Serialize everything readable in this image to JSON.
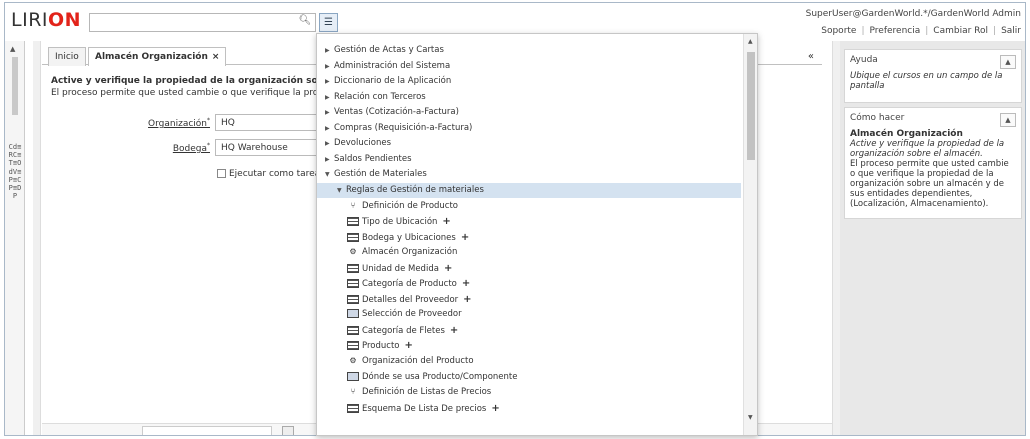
{
  "header": {
    "logo_a": "LIRI",
    "logo_b": "ON",
    "search_placeholder": "",
    "user": "SuperUser@GardenWorld.*/GardenWorld Admin",
    "links": [
      "Soporte",
      "Preferencia",
      "Cambiar Rol",
      "Salir"
    ]
  },
  "left_rail_text": "Cd≡RC≡T≡OdV≡P≡CP≡DP",
  "tabs": [
    "Inicio",
    "Almacén Organización"
  ],
  "process": {
    "title": "Active y verifique la propiedad de la organización sobre el alma",
    "desc": "El proceso permite que usted cambie o que verifique la propiedad d",
    "org_label": "Organización",
    "org_value": "HQ",
    "wh_label": "Bodega",
    "wh_value": "HQ Warehouse",
    "bg_label": "Ejecutar como tarea en"
  },
  "menu": {
    "items": [
      {
        "label": "Gestión de Actas y Cartas",
        "type": "folder"
      },
      {
        "label": "Administración del Sistema",
        "type": "folder"
      },
      {
        "label": "Diccionario de la Aplicación",
        "type": "folder"
      },
      {
        "label": "Relación con Terceros",
        "type": "folder"
      },
      {
        "label": "Ventas (Cotización-a-Factura)",
        "type": "folder"
      },
      {
        "label": "Compras (Requisición-a-Factura)",
        "type": "folder"
      },
      {
        "label": "Devoluciones",
        "type": "folder"
      },
      {
        "label": "Saldos Pendientes",
        "type": "folder"
      },
      {
        "label": "Gestión de Materiales",
        "type": "open"
      },
      {
        "label": "Reglas de Gestión de materiales",
        "type": "open-sub"
      },
      {
        "label": "Definición de Producto",
        "type": "flow"
      },
      {
        "label": "Tipo de Ubicación",
        "type": "window",
        "plus": true
      },
      {
        "label": "Bodega y Ubicaciones",
        "type": "window",
        "plus": true
      },
      {
        "label": "Almacén Organización",
        "type": "process"
      },
      {
        "label": "Unidad de Medida",
        "type": "window",
        "plus": true
      },
      {
        "label": "Categoría de Producto",
        "type": "window",
        "plus": true
      },
      {
        "label": "Detalles del Proveedor",
        "type": "window",
        "plus": true
      },
      {
        "label": "Selección de Proveedor",
        "type": "form"
      },
      {
        "label": "Categoría de Fletes",
        "type": "window",
        "plus": true
      },
      {
        "label": "Producto",
        "type": "window",
        "plus": true
      },
      {
        "label": "Organización del Producto",
        "type": "process"
      },
      {
        "label": "Dónde se usa Producto/Componente",
        "type": "form"
      },
      {
        "label": "Definición de Listas de Precios",
        "type": "flow"
      },
      {
        "label": "Esquema De Lista De precios",
        "type": "window",
        "plus": true
      }
    ]
  },
  "help": {
    "title": "Ayuda",
    "text": "Ubique el cursos en un campo de la pantalla"
  },
  "howto": {
    "title": "Cómo hacer",
    "heading": "Almacén Organización",
    "italic": "Active y verifique la propiedad de la organización sobre el almacén.",
    "body": "El proceso permite que usted cambie o que verifique la propiedad de la organización sobre un almacén y de sus entidades dependientes, (Localización, Almacenamiento)."
  }
}
